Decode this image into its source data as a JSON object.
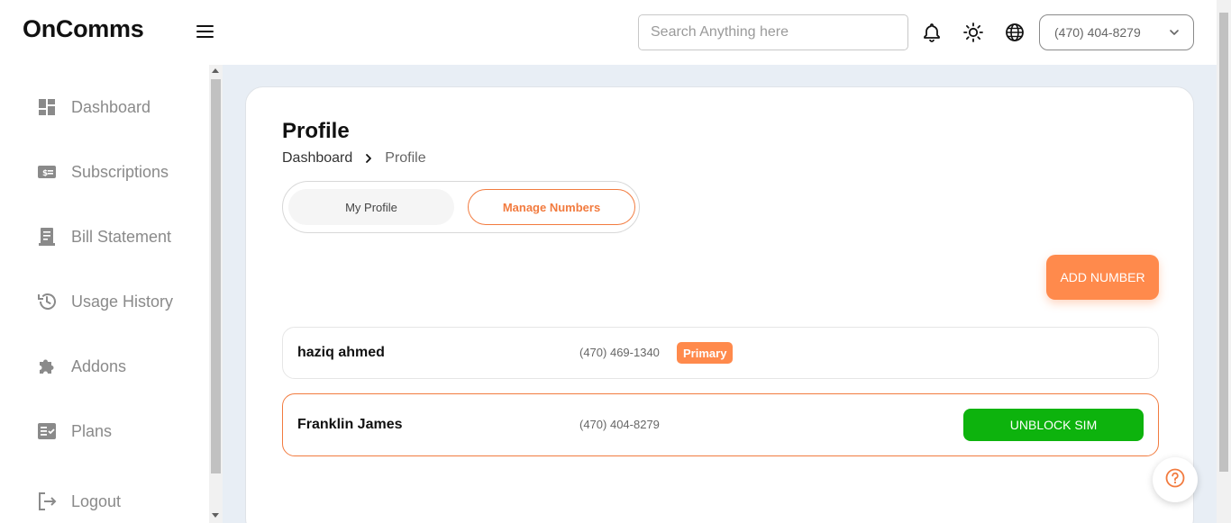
{
  "app": {
    "title": "OnComms"
  },
  "header": {
    "search_placeholder": "Search Anything here",
    "phone_selected": "(470) 404-8279"
  },
  "sidebar": {
    "items": [
      {
        "label": "Dashboard",
        "icon": "dashboard-icon"
      },
      {
        "label": "Subscriptions",
        "icon": "subscription-icon"
      },
      {
        "label": "Bill Statement",
        "icon": "receipt-icon"
      },
      {
        "label": "Usage History",
        "icon": "history-icon"
      },
      {
        "label": "Addons",
        "icon": "puzzle-icon"
      },
      {
        "label": "Plans",
        "icon": "checklist-icon"
      },
      {
        "label": "Logout",
        "icon": "logout-icon"
      }
    ]
  },
  "page": {
    "title": "Profile",
    "breadcrumb": {
      "root": "Dashboard",
      "current": "Profile"
    },
    "tabs": [
      {
        "label": "My Profile",
        "active": false
      },
      {
        "label": "Manage Numbers",
        "active": true
      }
    ],
    "add_button": "ADD NUMBER",
    "numbers": [
      {
        "name": "haziq ahmed",
        "number": "(470) 469-1340",
        "badge": "Primary"
      },
      {
        "name": "Franklin James",
        "number": "(470) 404-8279",
        "action": "UNBLOCK SIM"
      }
    ]
  },
  "colors": {
    "accent": "#ff8a4c",
    "success": "#0db30d",
    "background": "#e8eef5"
  }
}
